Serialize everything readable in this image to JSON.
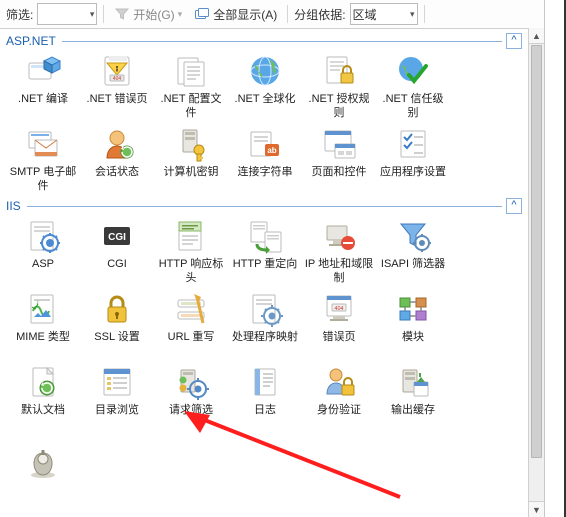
{
  "toolbar": {
    "filter_label": "筛选:",
    "filter_value": "",
    "start_label": "开始(G)",
    "show_all_label": "全部显示(A)",
    "group_by_label": "分组依据:",
    "group_by_value": "区域"
  },
  "groups": [
    {
      "id": "aspnet",
      "title": "ASP.NET",
      "items": [
        {
          "id": "net-compile",
          "label": ".NET 编译"
        },
        {
          "id": "net-error",
          "label": ".NET 错误页"
        },
        {
          "id": "net-config",
          "label": ".NET 配置文件"
        },
        {
          "id": "net-global",
          "label": ".NET 全球化"
        },
        {
          "id": "net-auth",
          "label": ".NET 授权规则"
        },
        {
          "id": "net-trust",
          "label": ".NET 信任级别"
        },
        {
          "id": "smtp-email",
          "label": "SMTP 电子邮件"
        },
        {
          "id": "session-state",
          "label": "会话状态"
        },
        {
          "id": "machine-key",
          "label": "计算机密钥"
        },
        {
          "id": "conn-strings",
          "label": "连接字符串"
        },
        {
          "id": "pages-controls",
          "label": "页面和控件"
        },
        {
          "id": "app-settings",
          "label": "应用程序设置"
        }
      ]
    },
    {
      "id": "iis",
      "title": "IIS",
      "items": [
        {
          "id": "asp",
          "label": "ASP"
        },
        {
          "id": "cgi",
          "label": "CGI"
        },
        {
          "id": "http-headers",
          "label": "HTTP 响应标头"
        },
        {
          "id": "http-redirect",
          "label": "HTTP 重定向"
        },
        {
          "id": "ip-domain",
          "label": "IP 地址和域限制"
        },
        {
          "id": "isapi-filter",
          "label": "ISAPI 筛选器"
        },
        {
          "id": "mime-types",
          "label": "MIME 类型"
        },
        {
          "id": "ssl-settings",
          "label": "SSL 设置"
        },
        {
          "id": "url-rewrite",
          "label": "URL 重写"
        },
        {
          "id": "handler-map",
          "label": "处理程序映射"
        },
        {
          "id": "error-pages",
          "label": "错误页"
        },
        {
          "id": "modules",
          "label": "模块"
        },
        {
          "id": "default-doc",
          "label": "默认文档"
        },
        {
          "id": "dir-browse",
          "label": "目录浏览"
        },
        {
          "id": "req-filter",
          "label": "请求筛选"
        },
        {
          "id": "logging",
          "label": "日志"
        },
        {
          "id": "auth-iis",
          "label": "身份验证"
        },
        {
          "id": "output-cache",
          "label": "输出缓存"
        }
      ]
    }
  ]
}
